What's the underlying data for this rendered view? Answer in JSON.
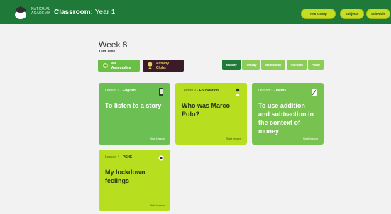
{
  "header": {
    "academy_line1": "OAK",
    "academy_line2": "NATIONAL",
    "academy_line3": "ACADEMY",
    "classroom_label": "Classroom:",
    "classroom_name": "Year 1",
    "nav": [
      "Year Group",
      "Subjects",
      "Schedule"
    ]
  },
  "week": {
    "title": "Week 8",
    "date": "15th June"
  },
  "filters": {
    "all_assemblies": "All Assemblies",
    "activity_clubs": "Activity Clubs"
  },
  "days": [
    "Monday",
    "Tuesday",
    "Wednesday",
    "Thursday",
    "Friday"
  ],
  "lessons": [
    {
      "number": "Lesson 1",
      "subject": "English",
      "title": "To listen to a story",
      "action": "Start lesson",
      "icon": "phone-icon"
    },
    {
      "number": "Lesson 2",
      "subject": "Foundation",
      "title": "Who was Marco Polo?",
      "action": "Start lesson",
      "icon": "explorer-icon"
    },
    {
      "number": "Lesson 3",
      "subject": "Maths",
      "title": "To use addition and subtraction in the context of money",
      "action": "Start lesson",
      "icon": "calculator-icon"
    },
    {
      "number": "Lesson 4",
      "subject": "PSHE",
      "title": "My lockdown feelings",
      "action": "Start lesson",
      "icon": "heart-icon"
    }
  ],
  "colors": {
    "header": "#1f7a3a",
    "nav_button": "#c6dd22",
    "card_green": "#6cbf52",
    "card_lime": "#b7df1f",
    "active_day": "#1f7a3a"
  }
}
